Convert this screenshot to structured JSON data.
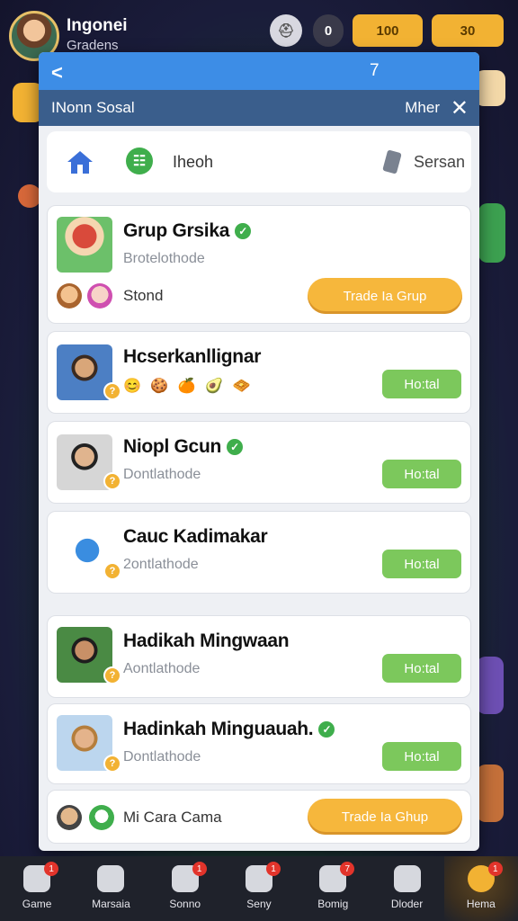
{
  "player": {
    "name": "Ingonei",
    "subtitle": "Gradens"
  },
  "top_icons": [
    {
      "icon": "helmet-icon",
      "value": ""
    },
    {
      "icon": "coin-icon",
      "value": "0"
    },
    {
      "icon": "gift-icon",
      "value": "100"
    },
    {
      "icon": "mail-icon",
      "value": "30"
    }
  ],
  "panel": {
    "header_number": "7",
    "subtitle": "INonn Sosal",
    "more_label": "Mher"
  },
  "tabbar": {
    "tab_label": "Iheoh",
    "search_label": "Sersan"
  },
  "cards": [
    {
      "title": "Grup Grsika",
      "subtitle": "Brotelothode",
      "mini_label": "Stond",
      "button": "Trade Ia Grup"
    },
    {
      "title": "Hcserkanllignar",
      "emojis": "😊 🍪 🍊 🥑 🧇",
      "button": "Ho:tal"
    },
    {
      "title": "Niopl Gcun",
      "subtitle": "Dontlathode",
      "button": "Ho:tal"
    },
    {
      "title": "Cauc Kadimakar",
      "subtitle": "2ontlathode",
      "button": "Ho:tal"
    },
    {
      "title": "Hadikah Mingwaan",
      "subtitle": "Aontlathode",
      "button": "Ho:tal"
    },
    {
      "title": "Hadinkah Minguauah.",
      "subtitle": "Dontlathode",
      "button": "Ho:tal"
    },
    {
      "mini_label": "Mi Cara Cama",
      "button": "Trade Ia Ghup"
    }
  ],
  "thumb_badges": [
    "?",
    "?",
    "?",
    "?",
    "?"
  ],
  "bottom_nav": [
    {
      "label": "Game",
      "icon": "home-icon",
      "badge": "1"
    },
    {
      "label": "Marsaia",
      "icon": "wrench-icon",
      "badge": ""
    },
    {
      "label": "Sonno",
      "icon": "chat-icon",
      "badge": "1"
    },
    {
      "label": "Seny",
      "icon": "people-icon",
      "badge": "1"
    },
    {
      "label": "Bomig",
      "icon": "shop-icon",
      "badge": "7"
    },
    {
      "label": "Dloder",
      "icon": "profile-icon",
      "badge": ""
    },
    {
      "label": "Hema",
      "icon": "sun-icon",
      "badge": "1"
    }
  ],
  "colors": {
    "header_blue": "#3d8de6",
    "subheader": "#3a5e8c",
    "button_green": "#7cc85c",
    "button_orange": "#f6b73c"
  }
}
